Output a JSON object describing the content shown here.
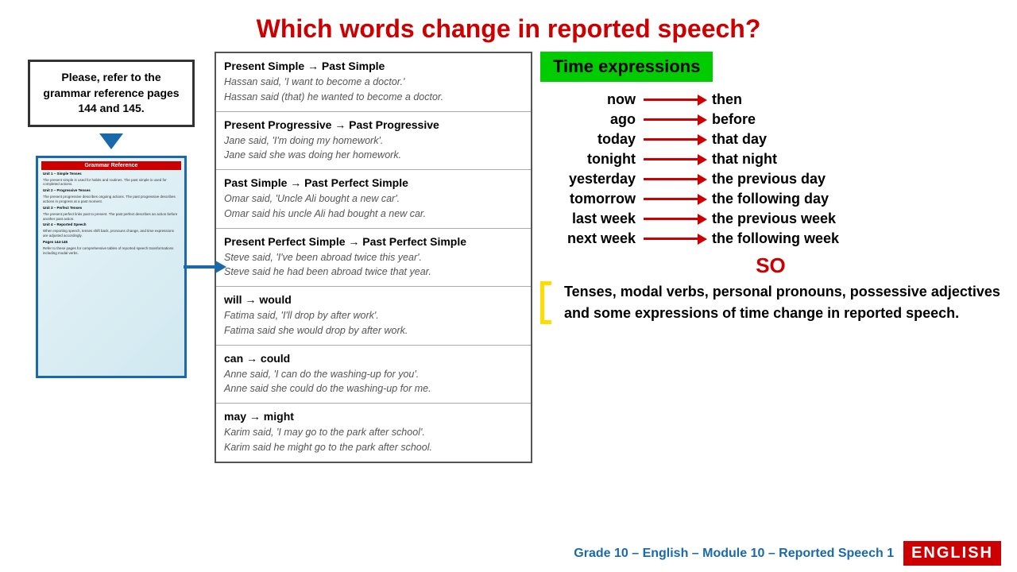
{
  "title": "Which words change in reported speech?",
  "grammar_box": {
    "text": "Please, refer to the grammar reference pages 144 and 145."
  },
  "grammar_sections": [
    {
      "title": "Present Simple → Past Simple",
      "examples": [
        "Hassan said, 'I want to become a doctor.'",
        "Hassan said (that) he wanted to become a doctor."
      ]
    },
    {
      "title": "Present Progressive → Past Progressive",
      "examples": [
        "Jane said, 'I'm doing my homework'.",
        "Jane said she was doing her homework."
      ]
    },
    {
      "title": "Past Simple → Past Perfect Simple",
      "examples": [
        "Omar said, 'Uncle Ali bought a new car'.",
        "Omar said his uncle Ali had bought a new car."
      ]
    },
    {
      "title": "Present Perfect Simple → Past Perfect Simple",
      "examples": [
        "Steve said, 'I've been abroad twice this year'.",
        "Steve said he had been abroad twice that year."
      ]
    },
    {
      "title": "will → would",
      "examples": [
        "Fatima said, 'I'll drop by after work'.",
        "Fatima said she would drop by after work."
      ]
    },
    {
      "title": "can → could",
      "examples": [
        "Anne said, 'I can do the washing-up for you'.",
        "Anne said she could do the washing-up for me."
      ]
    },
    {
      "title": "may → might",
      "examples": [
        "Karim said, 'I may go to the park after school'.",
        "Karim said he might go to the park after school."
      ]
    }
  ],
  "time_expressions": {
    "header": "Time expressions",
    "pairs": [
      {
        "left": "now",
        "right": "then"
      },
      {
        "left": "ago",
        "right": "before"
      },
      {
        "left": "today",
        "right": "that day"
      },
      {
        "left": "tonight",
        "right": "that night"
      },
      {
        "left": "yesterday",
        "right": "the previous day"
      },
      {
        "left": "tomorrow",
        "right": "the following day"
      },
      {
        "left": "last week",
        "right": "the previous week"
      },
      {
        "left": "next week",
        "right": "the following week"
      }
    ]
  },
  "so_label": "SO",
  "conclusion": "Tenses, modal verbs, personal pronouns, possessive adjectives and some expressions of time change in reported speech.",
  "footer": {
    "text": "Grade 10 – English – Module 10 – Reported Speech 1",
    "logo": "ENGLISH"
  }
}
